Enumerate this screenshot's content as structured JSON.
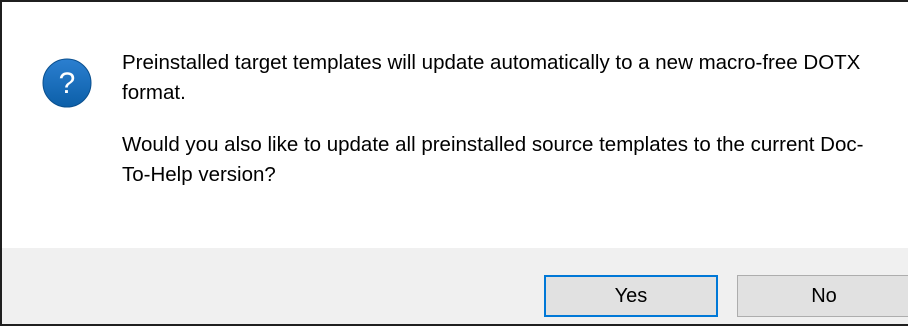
{
  "dialog": {
    "icon": "question-icon",
    "icon_glyph": "?",
    "accent_color": "#0c5fa8",
    "message_line1": "Preinstalled target templates will update automatically to a new macro-free DOTX format.",
    "message_line2": "Would you also like to update all preinstalled source templates to the current Doc-To-Help version?"
  },
  "buttons": {
    "yes_label": "Yes",
    "no_label": "No"
  }
}
